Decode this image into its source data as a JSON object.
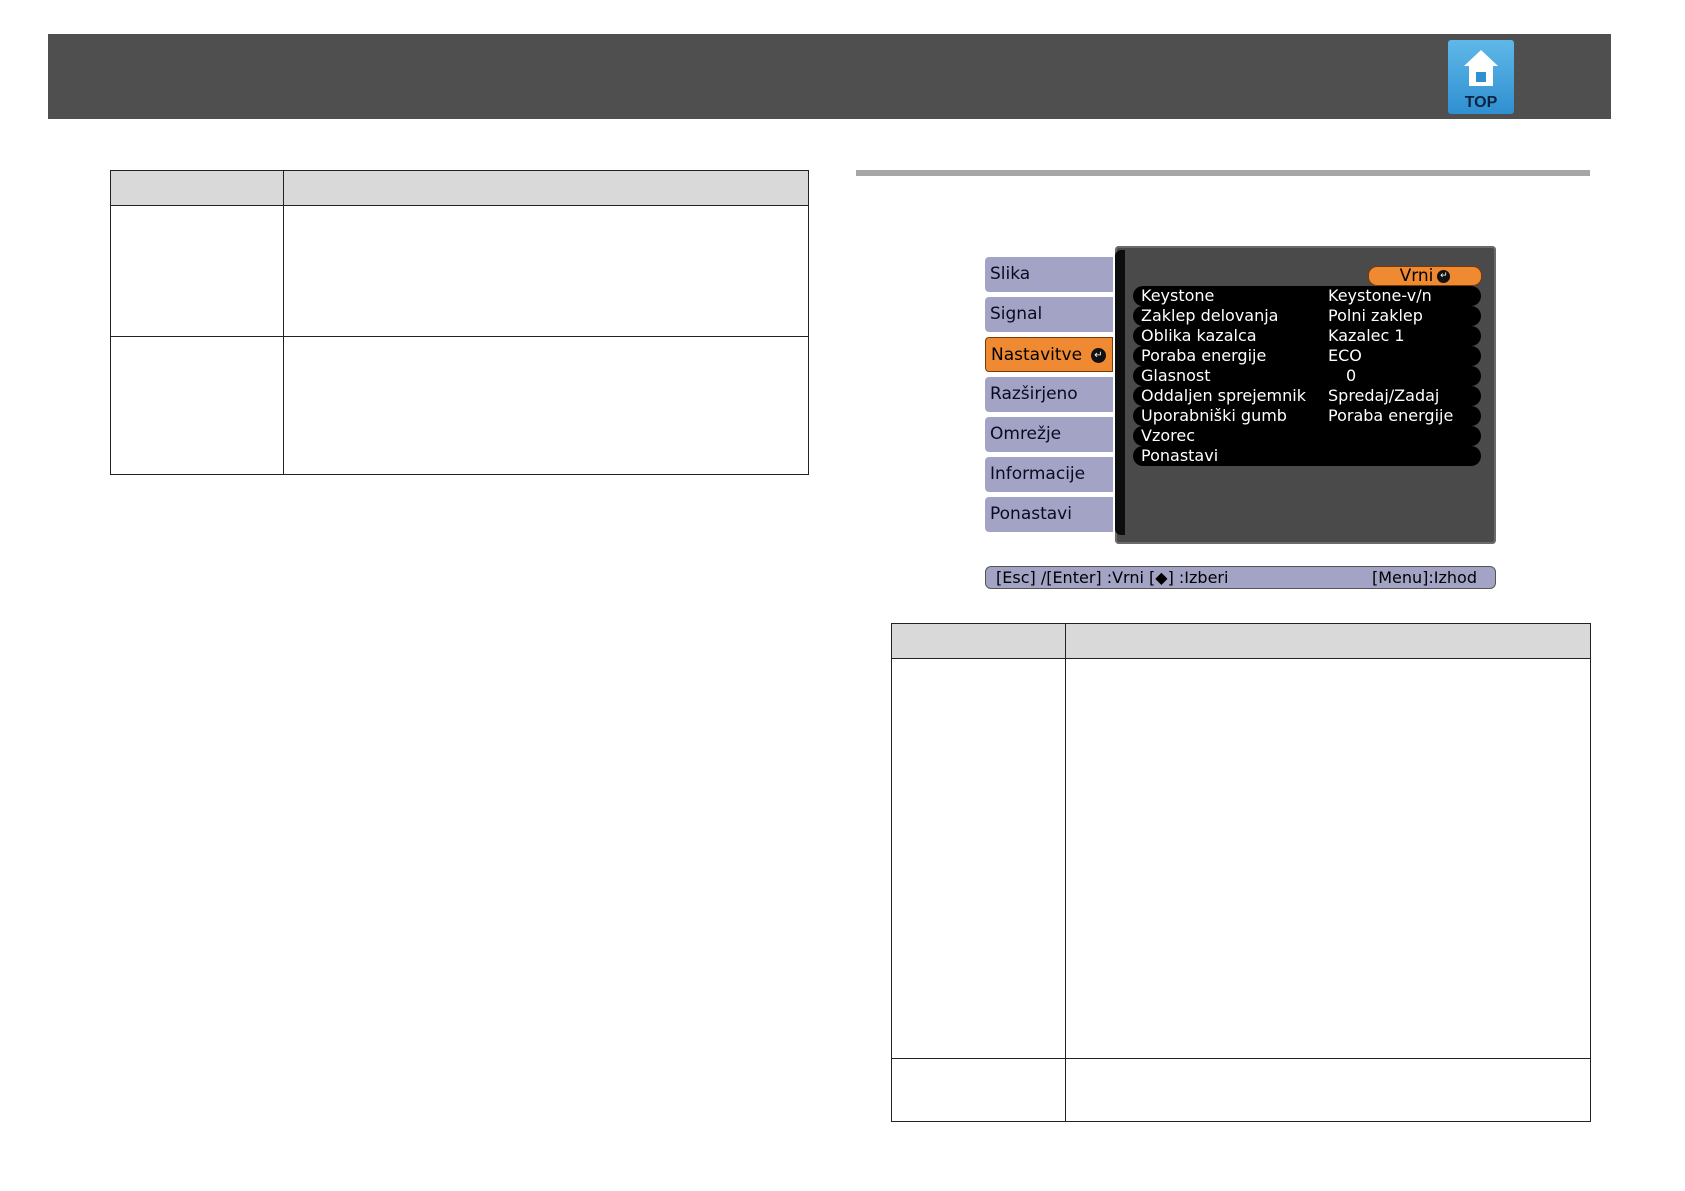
{
  "header": {
    "logo_label": "TOP"
  },
  "menu": {
    "tabs": [
      {
        "label": "Slika"
      },
      {
        "label": "Signal"
      },
      {
        "label": "Nastavitve"
      },
      {
        "label": "Razširjeno"
      },
      {
        "label": "Omrežje"
      },
      {
        "label": "Informacije"
      },
      {
        "label": "Ponastavi"
      }
    ],
    "active_tab": "Nastavitve",
    "return_label": "Vrni",
    "rows": [
      {
        "label": "Keystone",
        "value": "Keystone-v/n"
      },
      {
        "label": "Zaklep delovanja",
        "value": "Polni zaklep"
      },
      {
        "label": "Oblika kazalca",
        "value": "Kazalec 1"
      },
      {
        "label": "Poraba energije",
        "value": "ECO"
      },
      {
        "label": "Glasnost",
        "value": "0"
      },
      {
        "label": "Oddaljen sprejemnik",
        "value": "Spredaj/Zadaj"
      },
      {
        "label": "Uporabniški gumb",
        "value": "Poraba energije"
      },
      {
        "label": "Vzorec",
        "value": ""
      },
      {
        "label": "Ponastavi",
        "value": ""
      }
    ],
    "help_left": "[Esc] /[Enter] :Vrni  [◆] :Izberi",
    "help_right": "[Menu]:Izhod"
  },
  "colors": {
    "header_bar": "#4f4f4f",
    "tab": "#a3a3c5",
    "active_tab": "#f08a32",
    "table_header": "#d9d9d9"
  }
}
